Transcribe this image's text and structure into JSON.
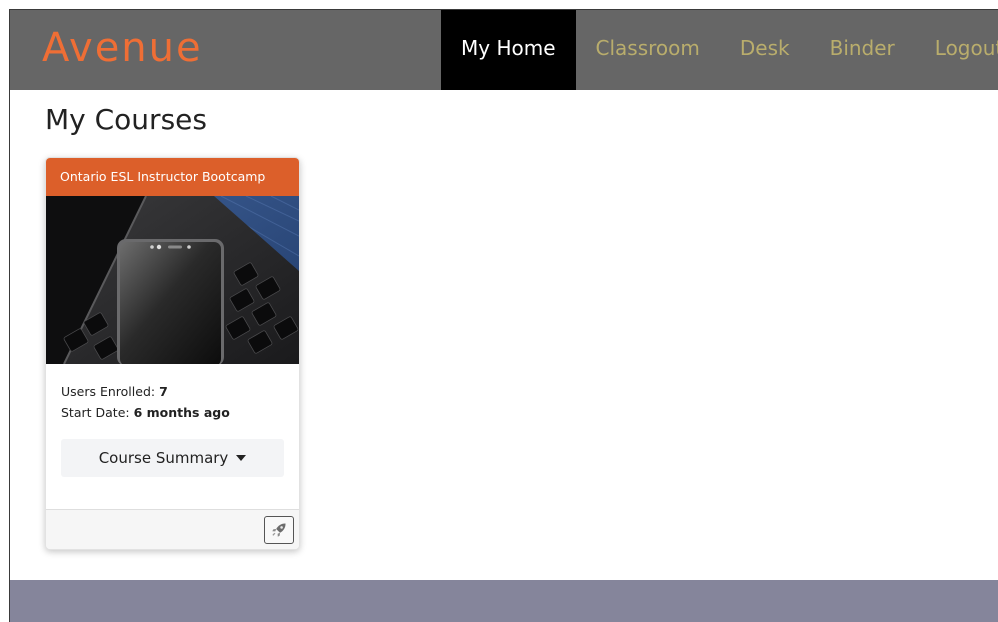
{
  "app": {
    "logo_text": "Avenue"
  },
  "nav": {
    "items": [
      {
        "label": "My Home",
        "active": true
      },
      {
        "label": "Classroom",
        "active": false
      },
      {
        "label": "Desk",
        "active": false
      },
      {
        "label": "Binder",
        "active": false
      },
      {
        "label": "Logout",
        "active": false
      }
    ]
  },
  "main": {
    "title": "My Courses",
    "courses": [
      {
        "name": "Ontario ESL Instructor Bootcamp",
        "users_enrolled_label": "Users Enrolled:",
        "users_enrolled": "7",
        "start_date_label": "Start Date:",
        "start_date": "6 months ago",
        "summary_button": "Course Summary",
        "footer_icon": "rocket-icon"
      }
    ]
  },
  "colors": {
    "navbar": "#666666",
    "logo": "#ef6e35",
    "nav_active_bg": "#000000",
    "nav_link": "#b9ad6c",
    "card_header": "#dc5f2a",
    "footer_band": "#85859b"
  }
}
